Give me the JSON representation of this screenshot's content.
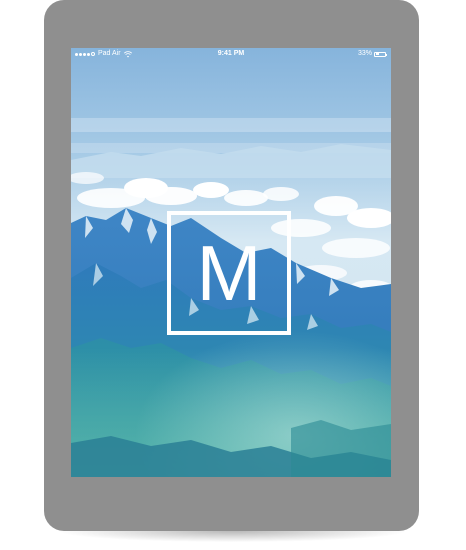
{
  "status_bar": {
    "carrier": "Pad Air",
    "time": "9:41 PM",
    "battery_percent_text": "33%",
    "battery_level": 0.33,
    "signal_bars": 5,
    "signal_filled": 4
  },
  "splash": {
    "logo_letter": "M"
  },
  "icons": {
    "signal": "signal-dots-icon",
    "wifi": "wifi-icon",
    "battery": "battery-icon"
  },
  "colors": {
    "device_frame": "#8f8f8f",
    "logo": "#ffffff",
    "status_text": "#ffffff"
  }
}
